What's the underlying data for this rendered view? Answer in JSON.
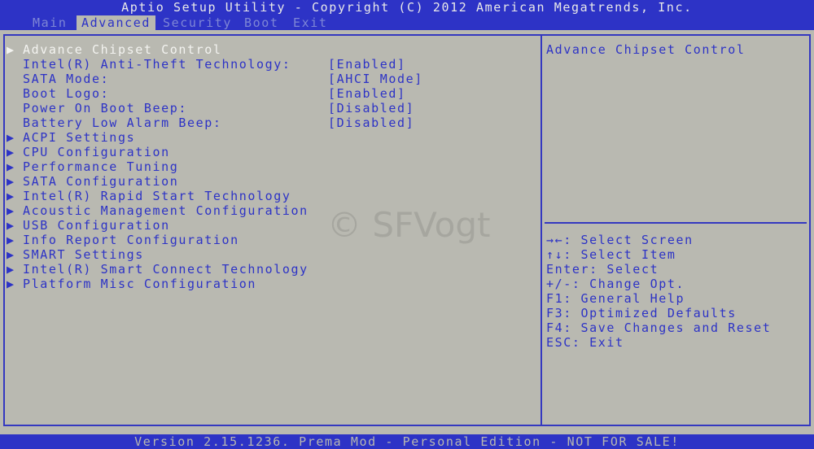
{
  "title": "Aptio Setup Utility - Copyright (C) 2012 American Megatrends, Inc.",
  "tabs": [
    {
      "label": "Main"
    },
    {
      "label": "Advanced"
    },
    {
      "label": "Security"
    },
    {
      "label": "Boot"
    },
    {
      "label": "Exit"
    }
  ],
  "active_tab": "Advanced",
  "menu": {
    "submenu_marker": "▶",
    "items": [
      {
        "label": "Advance Chipset Control"
      },
      {
        "label": "Intel(R) Anti-Theft Technology:",
        "value": "[Enabled]"
      },
      {
        "label": "SATA Mode:",
        "value": "[AHCI Mode]"
      },
      {
        "label": "Boot Logo:",
        "value": "[Enabled]"
      },
      {
        "label": "Power On Boot Beep:",
        "value": "[Disabled]"
      },
      {
        "label": "Battery Low Alarm Beep:",
        "value": "[Disabled]"
      },
      {
        "label": "ACPI Settings"
      },
      {
        "label": "CPU Configuration"
      },
      {
        "label": "Performance Tuning"
      },
      {
        "label": "SATA Configuration"
      },
      {
        "label": "Intel(R) Rapid Start Technology"
      },
      {
        "label": "Acoustic Management Configuration"
      },
      {
        "label": "USB Configuration"
      },
      {
        "label": "Info Report Configuration"
      },
      {
        "label": "SMART Settings"
      },
      {
        "label": "Intel(R) Smart Connect Technology"
      },
      {
        "label": "Platform Misc Configuration"
      }
    ]
  },
  "help": {
    "title": "Advance Chipset Control",
    "keys": [
      "→←: Select Screen",
      "↑↓: Select Item",
      "Enter: Select",
      "+/-: Change Opt.",
      "F1: General Help",
      "F3: Optimized Defaults",
      "F4: Save Changes and Reset",
      "ESC: Exit"
    ]
  },
  "watermark": "© SFVogt",
  "footer": "Version 2.15.1236. Prema Mod - Personal Edition - NOT FOR SALE!",
  "colors": {
    "background": "#b9b9b1",
    "accent_blue": "#2d33c6",
    "selected_text": "#f3f3f0"
  }
}
